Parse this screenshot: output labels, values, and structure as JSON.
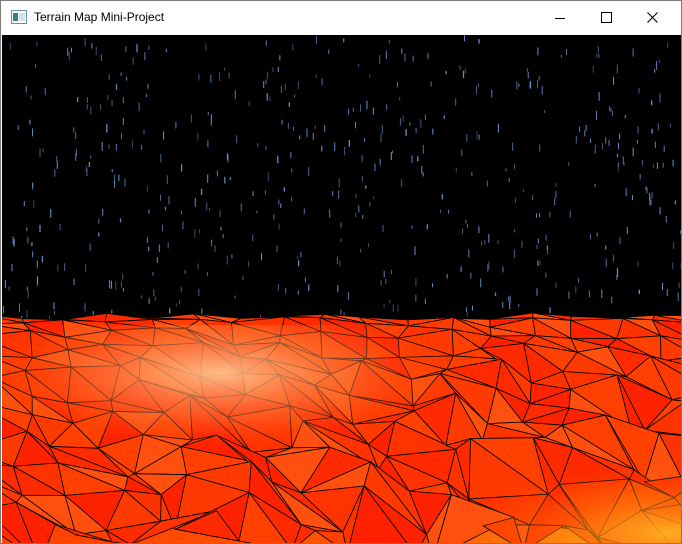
{
  "window": {
    "title": "Terrain Map Mini-Project",
    "app_icon": "window-app-icon",
    "controls": [
      "minimize-icon",
      "maximize-icon",
      "close-icon"
    ]
  },
  "scene": {
    "sky_color": "#000000",
    "star_color": "#6f9fe0",
    "terrain_colors": [
      "#ff1a00",
      "#ff3b00",
      "#ff6a10",
      "#ffb070",
      "#ffa020"
    ],
    "wire_color": "#000000"
  }
}
